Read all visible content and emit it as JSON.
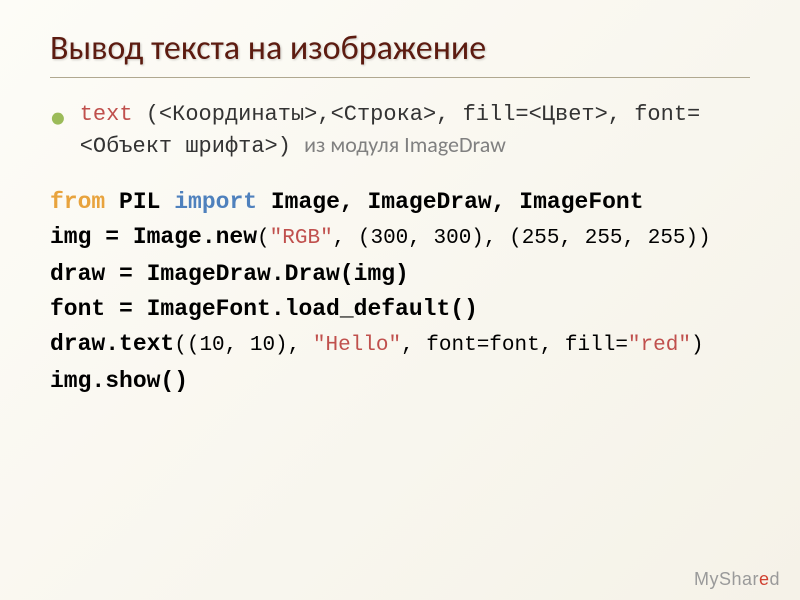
{
  "title": "Вывод текста на изображение",
  "signature": {
    "fn": "text",
    "args": " (<Координаты>,<Строка>, fill=<Цвет>, font=<Объект шрифта>) ",
    "tail": "из модуля ImageDraw"
  },
  "code": {
    "l1_from": "from",
    "l1_mod": " PIL ",
    "l1_import": "import",
    "l1_rest": " Image, ImageDraw, ImageFont",
    "l2a": "img = Image.new",
    "l2_call_open": "(",
    "l2_str": "\"RGB\"",
    "l2_call_rest": ", (300, 300), (255, 255, 255))",
    "l3": "draw = ImageDraw.Draw(img)",
    "l4": "font = ImageFont.load_default()",
    "l5a": "draw.text",
    "l5_call_open": "((10, 10), ",
    "l5_str1": "\"Hello\"",
    "l5_mid": ", font=font, fill=",
    "l5_str2": "\"red\"",
    "l5_close": ")",
    "l6": "img.show()"
  },
  "watermark": {
    "pre": "MyShar",
    "red": "e",
    "post": "d"
  }
}
